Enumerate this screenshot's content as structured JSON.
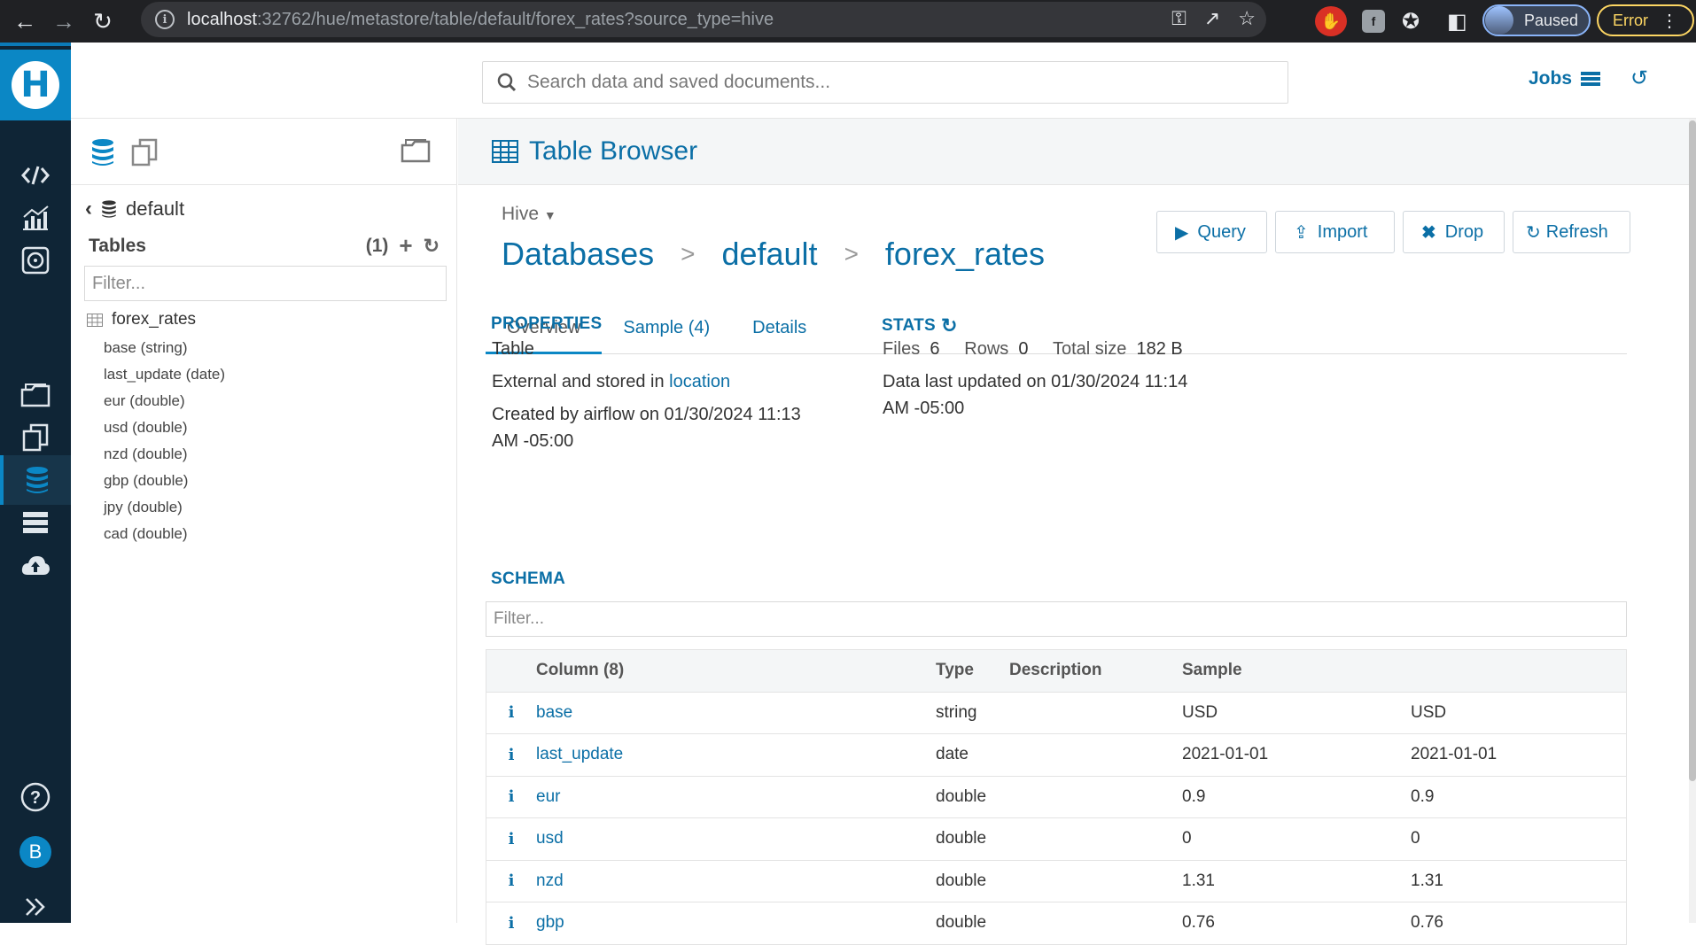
{
  "browser": {
    "url_host": "localhost",
    "url_rest": ":32762/hue/metastore/table/default/forex_rates?source_type=hive",
    "profile_label": "Paused",
    "error_label": "Error"
  },
  "header": {
    "search_placeholder": "Search data and saved documents...",
    "jobs_label": "Jobs"
  },
  "user": {
    "initial": "B"
  },
  "assist": {
    "database": "default",
    "tables_label": "Tables",
    "tables_count": "(1)",
    "filter_placeholder": "Filter...",
    "table_name": "forex_rates",
    "columns": [
      "base (string)",
      "last_update (date)",
      "eur (double)",
      "usd (double)",
      "nzd (double)",
      "gbp (double)",
      "jpy (double)",
      "cad (double)"
    ]
  },
  "main": {
    "title": "Table Browser",
    "source": "Hive",
    "breadcrumb": [
      "Databases",
      "default",
      "forex_rates"
    ],
    "separator": ">",
    "actions": {
      "query": "Query",
      "import": "Import",
      "drop": "Drop",
      "refresh": "Refresh"
    },
    "tabs": [
      "Overview",
      "Sample (4)",
      "Details"
    ],
    "properties": {
      "title": "PROPERTIES",
      "type": "Table",
      "external_prefix": "External and stored in ",
      "location_link": "location",
      "created_line1": "Created by airflow on 01/30/2024 11:13",
      "created_line2": "AM -05:00"
    },
    "stats": {
      "title": "STATS",
      "files_label": "Files",
      "files_value": "6",
      "rows_label": "Rows",
      "rows_value": "0",
      "size_label": "Total size",
      "size_value": "182 B",
      "updated_line1": "Data last updated on 01/30/2024 11:14",
      "updated_line2": "AM -05:00"
    },
    "schema": {
      "title": "SCHEMA",
      "filter_placeholder": "Filter...",
      "headers": {
        "column": "Column (8)",
        "type": "Type",
        "description": "Description",
        "sample": "Sample"
      },
      "rows": [
        {
          "name": "base",
          "type": "string",
          "s1": "USD",
          "s2": "USD"
        },
        {
          "name": "last_update",
          "type": "date",
          "s1": "2021-01-01",
          "s2": "2021-01-01"
        },
        {
          "name": "eur",
          "type": "double",
          "s1": "0.9",
          "s2": "0.9"
        },
        {
          "name": "usd",
          "type": "double",
          "s1": "0",
          "s2": "0"
        },
        {
          "name": "nzd",
          "type": "double",
          "s1": "1.31",
          "s2": "1.31"
        },
        {
          "name": "gbp",
          "type": "double",
          "s1": "0.76",
          "s2": "0.76"
        }
      ]
    }
  }
}
